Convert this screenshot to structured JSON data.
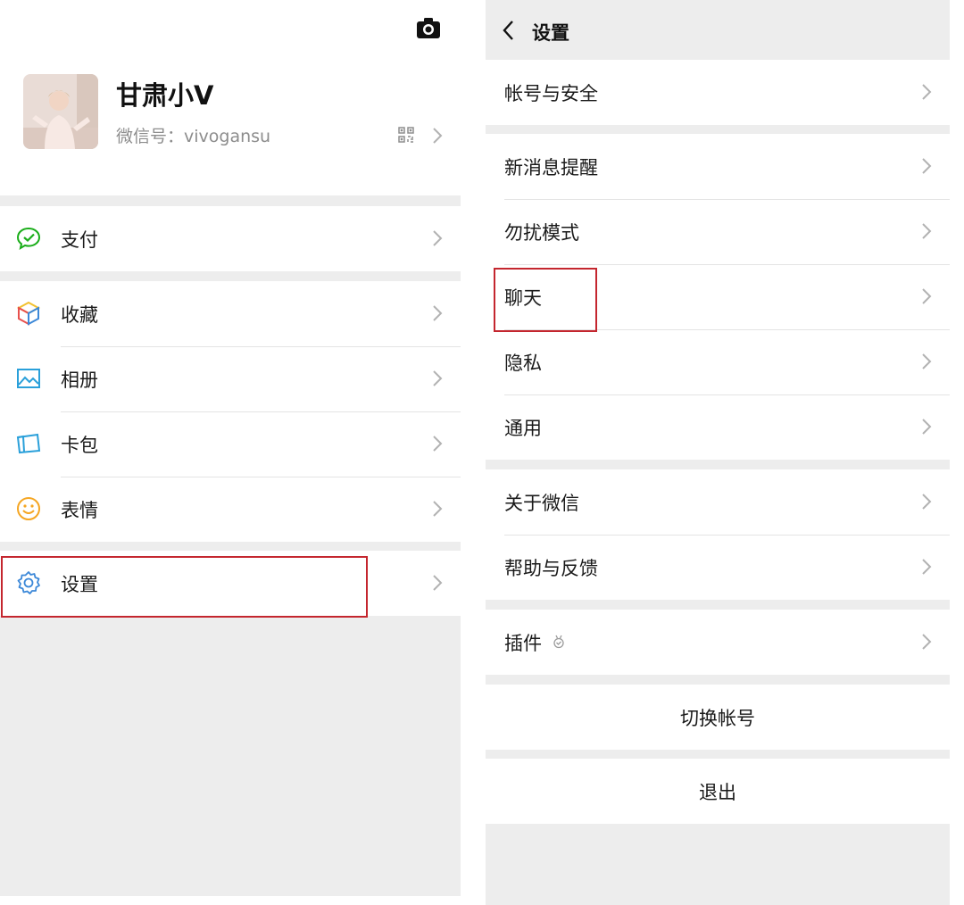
{
  "left": {
    "profile": {
      "name": "甘肃小V",
      "wechat_id": "微信号：vivogansu",
      "camera_icon": "camera-icon",
      "qr_icon": "qr-code-icon"
    },
    "menu": {
      "pay": {
        "label": "支付",
        "icon": "wechat-pay-icon",
        "color": "#1aad19"
      },
      "favorites": {
        "label": "收藏",
        "icon": "favorites-cube-icon"
      },
      "album": {
        "label": "相册",
        "icon": "album-icon",
        "color": "#2aa0da"
      },
      "cards": {
        "label": "卡包",
        "icon": "card-wallet-icon",
        "color": "#2aa0da"
      },
      "stickers": {
        "label": "表情",
        "icon": "emoji-icon",
        "color": "#f5a623"
      },
      "settings": {
        "label": "设置",
        "icon": "gear-icon",
        "color": "#3c88d8"
      }
    }
  },
  "right": {
    "header": {
      "title": "设置",
      "back_icon": "back-arrow-icon"
    },
    "groups": {
      "account": {
        "label": "帐号与安全"
      },
      "general": [
        {
          "label": "新消息提醒"
        },
        {
          "label": "勿扰模式"
        },
        {
          "label": "聊天"
        },
        {
          "label": "隐私"
        },
        {
          "label": "通用"
        }
      ],
      "about": [
        {
          "label": "关于微信"
        },
        {
          "label": "帮助与反馈"
        }
      ],
      "plugins": {
        "label": "插件",
        "icon": "plugin-icon"
      }
    },
    "switch_account": "切换帐号",
    "logout": "退出"
  },
  "colors": {
    "background": "#ededed",
    "highlight_border": "#c4262e",
    "chevron": "#b2b2b2"
  }
}
